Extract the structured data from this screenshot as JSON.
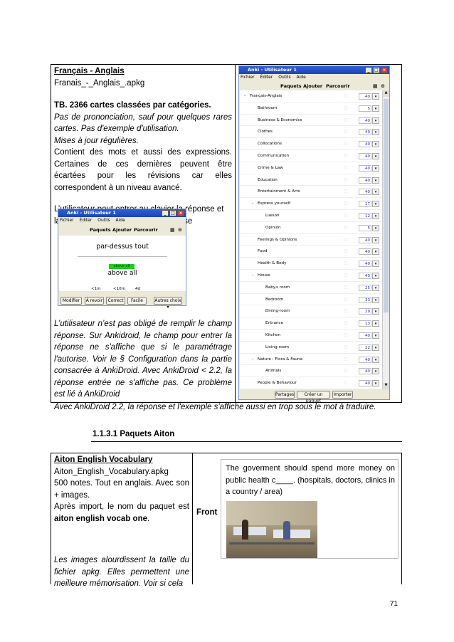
{
  "top_box": {
    "title": "Français - Anglais",
    "filename": "Franais_-_Anglais_.apkg",
    "bold_line": "TB. 2366 cartes classées par catégories.",
    "italic_par": "Pas de prononciation, sauf pour quelques rares cartes. Pas d'exemple d'utilisation.",
    "italic_line2": "Mises à jour régulières.",
    "body1": "Contient des mots et aussi des expressions. Certaines de ces dernières peuvent être écartées pour les révisions car elles correspondent à un niveau avancé.",
    "body2": "L’utilisateur peut entrer au clavier la réponse et la carte réponse montre cette réponse",
    "italic_bottom": "L’utilisateur n’est pas obligé de remplir le champ réponse. Sur Ankidroid, le champ pour entrer la réponse ne s'affiche que si le paramétrage l'autorise. Voir le § Configuration dans la partie consacrée à AnkiDroid. Avec AnkiDroid < 2.2, la réponse entrée ne s'affiche pas. Ce problème est lié à AnkiDroid",
    "footnote": "Avec AnkiDroid 2.2, la réponse et l'exemple s'affiche aussi en trop sous le mot à traduire."
  },
  "small_window": {
    "title": "Anki - Utilisateur 1",
    "menu": [
      "Fichier",
      "Éditer",
      "Outils",
      "Aide"
    ],
    "toolbar": [
      "Paquets",
      "Ajouter",
      "Parcourir"
    ],
    "question": "par-dessus tout",
    "typed_answer": "above all",
    "answer": "above all",
    "intervals": [
      "<1m",
      "<10m",
      "4d"
    ],
    "buttons": [
      "Modifier",
      "À revoir",
      "Correct",
      "Facile",
      "Autres choix ▾"
    ]
  },
  "big_window": {
    "title": "Anki - Utilisateur 1",
    "menu": [
      "Fichier",
      "Éditer",
      "Outils",
      "Aide"
    ],
    "toolbar": [
      "Paquets",
      "Ajouter",
      "Parcourir"
    ],
    "decks": [
      {
        "name": "Français-Anglais",
        "count": "40",
        "level": 0,
        "expander": "-"
      },
      {
        "name": "Bathroom",
        "count": "5",
        "level": 1,
        "expander": ""
      },
      {
        "name": "Business & Economics",
        "count": "40",
        "level": 1,
        "expander": ""
      },
      {
        "name": "Clothes",
        "count": "40",
        "level": 1,
        "expander": ""
      },
      {
        "name": "Collocations",
        "count": "40",
        "level": 1,
        "expander": ""
      },
      {
        "name": "Communication",
        "count": "40",
        "level": 1,
        "expander": ""
      },
      {
        "name": "Crime & Law",
        "count": "40",
        "level": 1,
        "expander": ""
      },
      {
        "name": "Education",
        "count": "40",
        "level": 1,
        "expander": ""
      },
      {
        "name": "Entertainment & Arts",
        "count": "40",
        "level": 1,
        "expander": ""
      },
      {
        "name": "Express yourself",
        "count": "17",
        "level": 1,
        "expander": "-"
      },
      {
        "name": "Liaison",
        "count": "12",
        "level": 2,
        "expander": ""
      },
      {
        "name": "Opinion",
        "count": "5",
        "level": 2,
        "expander": ""
      },
      {
        "name": "Feelings & Opinions",
        "count": "40",
        "level": 1,
        "expander": ""
      },
      {
        "name": "Food",
        "count": "40",
        "level": 1,
        "expander": ""
      },
      {
        "name": "Health & Body",
        "count": "40",
        "level": 1,
        "expander": ""
      },
      {
        "name": "House",
        "count": "40",
        "level": 1,
        "expander": "-"
      },
      {
        "name": "Baby.s room",
        "count": "25",
        "level": 2,
        "expander": ""
      },
      {
        "name": "Bedroom",
        "count": "33",
        "level": 2,
        "expander": ""
      },
      {
        "name": "Dining-room",
        "count": "29",
        "level": 2,
        "expander": ""
      },
      {
        "name": "Entrance",
        "count": "13",
        "level": 2,
        "expander": ""
      },
      {
        "name": "Kitchen",
        "count": "40",
        "level": 2,
        "expander": ""
      },
      {
        "name": "Living-room",
        "count": "22",
        "level": 2,
        "expander": ""
      },
      {
        "name": "Nature : Flora & Fauna",
        "count": "40",
        "level": 1,
        "expander": "-"
      },
      {
        "name": "Animals",
        "count": "40",
        "level": 2,
        "expander": ""
      },
      {
        "name": "People & Behaviour",
        "count": "40",
        "level": 1,
        "expander": ""
      }
    ],
    "bottom_buttons": [
      "Partages",
      "Créer un paquet",
      "Importer"
    ]
  },
  "section_heading": "1.1.3.1 Paquets Aiton",
  "aiton": {
    "title": "Aiton English Vocabulary",
    "filename": "Aiton_English_Vocabulary.apkg",
    "line_notes": "500 notes. Tout en anglais. Avec son + images.",
    "after_import_prefix": "Après import, le nom du paquet est ",
    "after_import_bold": "aiton english vocab one",
    "after_import_suffix": ".",
    "italic_note": "Les images alourdissent la taille du fichier apkg. Elles permettent une meilleure mémorisation. Voir si cela",
    "front_label": "Front",
    "card_text": "The goverment should spend more money on public health c____. (hospitals, doctors, clinics in a country / area)"
  },
  "page_number": "71"
}
